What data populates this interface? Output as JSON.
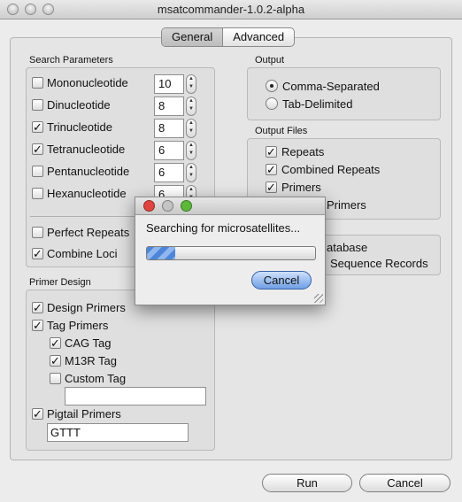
{
  "window": {
    "title": "msatcommander-1.0.2-alpha"
  },
  "tabs": [
    {
      "label": "General",
      "selected": true
    },
    {
      "label": "Advanced",
      "selected": false
    }
  ],
  "search_parameters": {
    "title": "Search Parameters",
    "rows": [
      {
        "label": "Mononucleotide",
        "checked": false,
        "value": "10"
      },
      {
        "label": "Dinucleotide",
        "checked": false,
        "value": "8"
      },
      {
        "label": "Trinucleotide",
        "checked": true,
        "value": "8"
      },
      {
        "label": "Tetranucleotide",
        "checked": true,
        "value": "6"
      },
      {
        "label": "Pentanucleotide",
        "checked": false,
        "value": "6"
      },
      {
        "label": "Hexanucleotide",
        "checked": false,
        "value": "6"
      }
    ],
    "perfect_repeats": {
      "label": "Perfect Repeats",
      "checked": false
    },
    "combine_loci": {
      "label": "Combine Loci",
      "checked": true
    }
  },
  "primer_design": {
    "title": "Primer Design",
    "design_primers": {
      "label": "Design Primers",
      "checked": true
    },
    "tag_primers": {
      "label": "Tag Primers",
      "checked": true
    },
    "cag_tag": {
      "label": "CAG Tag",
      "checked": true
    },
    "m13r_tag": {
      "label": "M13R Tag",
      "checked": true
    },
    "custom_tag": {
      "label": "Custom Tag",
      "checked": false,
      "value": ""
    },
    "pigtail_primers": {
      "label": "Pigtail Primers",
      "checked": true,
      "value": "GTTT"
    }
  },
  "output": {
    "title": "Output",
    "options": [
      {
        "label": "Comma-Separated",
        "selected": true
      },
      {
        "label": "Tab-Delimited",
        "selected": false
      }
    ]
  },
  "output_files": {
    "title": "Output Files",
    "items": [
      {
        "label": "Repeats",
        "checked": true
      },
      {
        "label": "Combined Repeats",
        "checked": true
      },
      {
        "label": "Primers",
        "checked": true
      },
      {
        "label": "Primers",
        "checked": true
      }
    ]
  },
  "database": {
    "line1": "atabase",
    "line2": "Sequence Records"
  },
  "buttons": {
    "run": "Run",
    "cancel": "Cancel"
  },
  "progress_dialog": {
    "message": "Searching for microsatellites...",
    "progress": 0.17,
    "cancel_label": "Cancel",
    "colors": {
      "close": "#e0443e",
      "minimize": "#c4c4c4",
      "zoom": "#5cb83a",
      "progress": "#4d86d8"
    }
  }
}
